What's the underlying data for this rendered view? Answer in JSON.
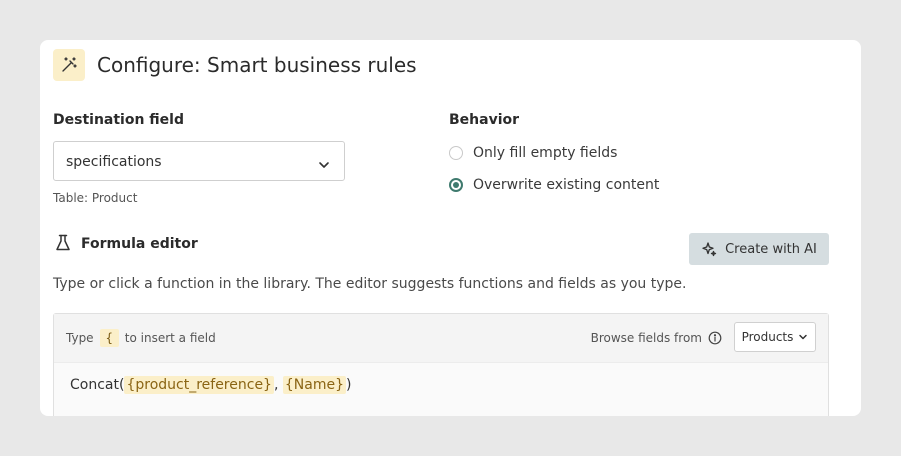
{
  "header": {
    "title": "Configure: Smart business rules",
    "icon": "magic-wand-icon"
  },
  "destination": {
    "label": "Destination field",
    "value": "specifications",
    "caption": "Table: Product"
  },
  "behavior": {
    "label": "Behavior",
    "options": [
      {
        "label": "Only fill empty fields",
        "checked": false
      },
      {
        "label": "Overwrite existing content",
        "checked": true
      }
    ]
  },
  "formula_editor": {
    "title": "Formula editor",
    "ai_button_label": "Create with AI",
    "description": "Type or click a function in the library. The editor suggests functions and fields as you type.",
    "hint_prefix": "Type",
    "hint_brace": "{",
    "hint_suffix": "to insert a field",
    "browse_label": "Browse fields from",
    "browse_table": "Products",
    "formula": {
      "function": "Concat",
      "open": "(",
      "field_1": "{product_reference}",
      "separator": ", ",
      "field_2": "{Name}",
      "close": ")"
    }
  },
  "colors": {
    "accent": "#3f7a6e",
    "token_bg": "#fbefc9",
    "ai_button_bg": "#d5dde0"
  }
}
